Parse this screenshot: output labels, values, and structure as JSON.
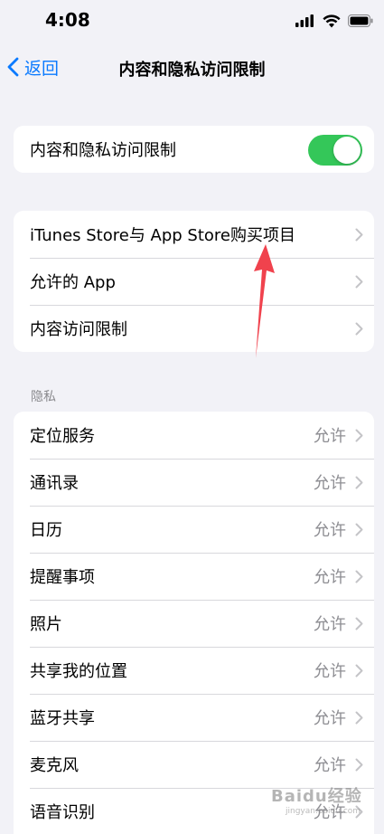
{
  "status_bar": {
    "time": "4:08"
  },
  "nav": {
    "back_label": "返回",
    "title": "内容和隐私访问限制"
  },
  "toggle_card": {
    "label": "内容和隐私访问限制",
    "enabled": true,
    "color": "#34c759"
  },
  "store_card": {
    "items": [
      {
        "label": "iTunes Store与 App Store购买项目"
      },
      {
        "label": "允许的 App"
      },
      {
        "label": "内容访问限制"
      }
    ]
  },
  "privacy": {
    "header": "隐私",
    "items": [
      {
        "label": "定位服务",
        "value": "允许"
      },
      {
        "label": "通讯录",
        "value": "允许"
      },
      {
        "label": "日历",
        "value": "允许"
      },
      {
        "label": "提醒事项",
        "value": "允许"
      },
      {
        "label": "照片",
        "value": "允许"
      },
      {
        "label": "共享我的位置",
        "value": "允许"
      },
      {
        "label": "蓝牙共享",
        "value": "允许"
      },
      {
        "label": "麦克风",
        "value": "允许"
      },
      {
        "label": "语音识别",
        "value": "允许"
      }
    ]
  },
  "watermark": {
    "text": "Baidu经验",
    "sub": "jingyan.baidu.com"
  },
  "colors": {
    "accent": "#0a7aff",
    "background": "#f2f2f7",
    "annotation_arrow": "#f0424d"
  }
}
